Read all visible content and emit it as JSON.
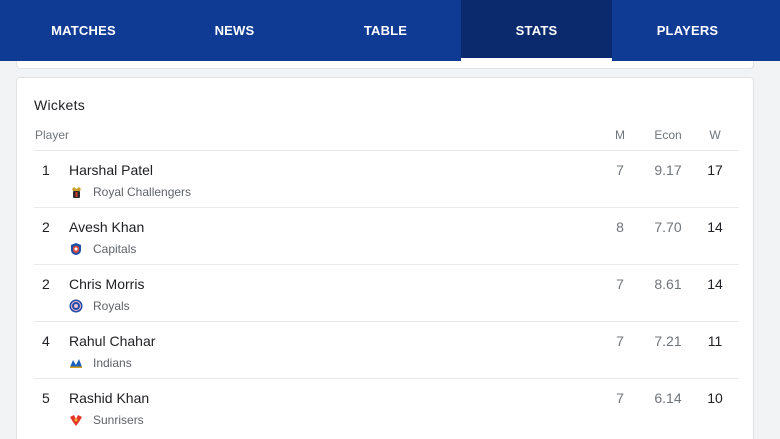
{
  "tabs": [
    {
      "label": "MATCHES"
    },
    {
      "label": "NEWS"
    },
    {
      "label": "TABLE"
    },
    {
      "label": "STATS"
    },
    {
      "label": "PLAYERS"
    }
  ],
  "active_tab": "STATS",
  "section": {
    "title": "Wickets",
    "columns": {
      "player": "Player",
      "matches": "M",
      "econ": "Econ",
      "wickets": "W"
    }
  },
  "rows": [
    {
      "rank": "1",
      "player": "Harshal Patel",
      "team": "Royal Challengers",
      "team_icon": "royal-challengers-logo-icon",
      "m": "7",
      "econ": "9.17",
      "w": "17"
    },
    {
      "rank": "2",
      "player": "Avesh Khan",
      "team": "Capitals",
      "team_icon": "capitals-logo-icon",
      "m": "8",
      "econ": "7.70",
      "w": "14"
    },
    {
      "rank": "2",
      "player": "Chris Morris",
      "team": "Royals",
      "team_icon": "royals-logo-icon",
      "m": "7",
      "econ": "8.61",
      "w": "14"
    },
    {
      "rank": "4",
      "player": "Rahul Chahar",
      "team": "Indians",
      "team_icon": "indians-logo-icon",
      "m": "7",
      "econ": "7.21",
      "w": "11"
    },
    {
      "rank": "5",
      "player": "Rashid Khan",
      "team": "Sunrisers",
      "team_icon": "sunrisers-logo-icon",
      "m": "7",
      "econ": "6.14",
      "w": "10"
    }
  ],
  "colors": {
    "tabbar": "#0f3b95",
    "active_tab": "#0b2a6e"
  }
}
